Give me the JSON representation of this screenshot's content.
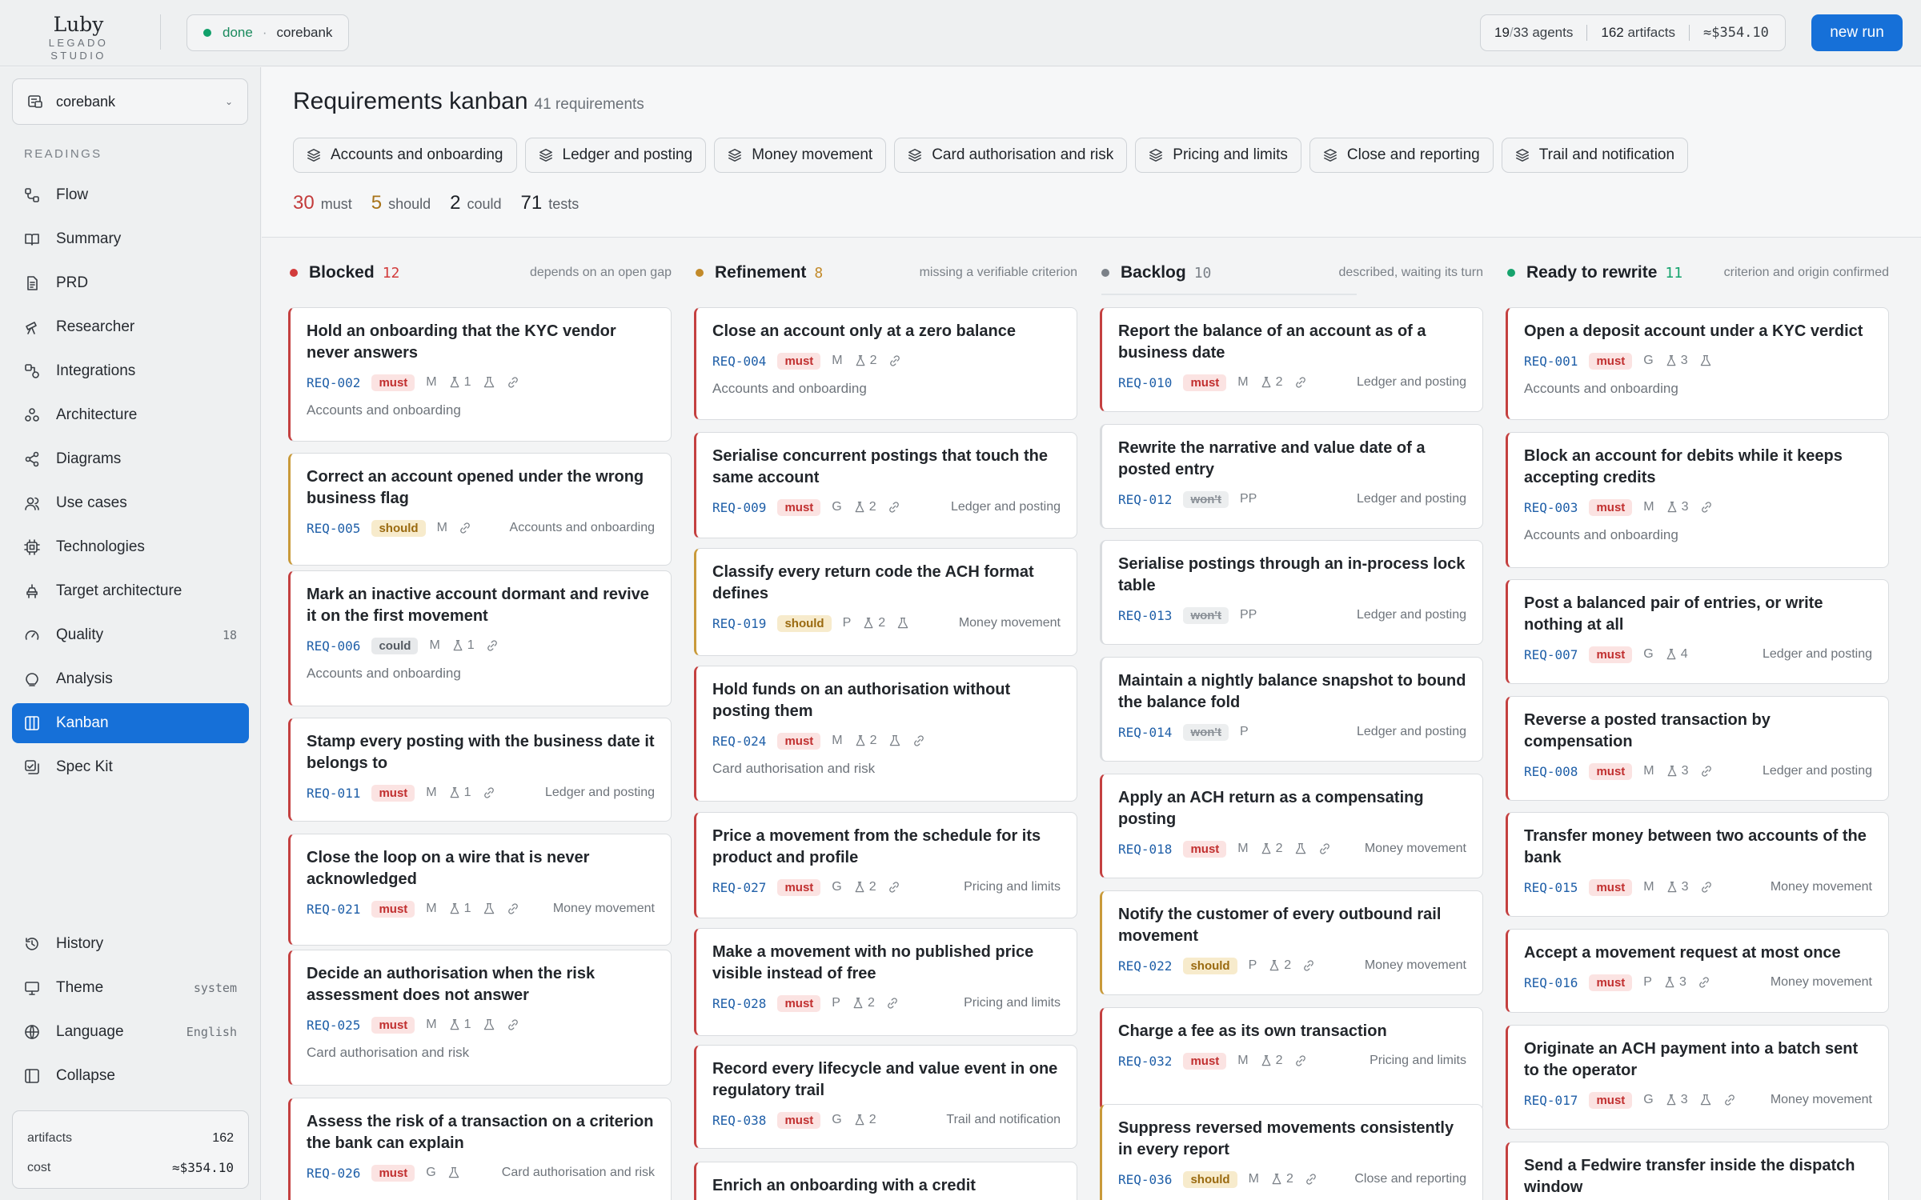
{
  "app": {
    "logo": "Luby",
    "logo_sub": "LEGADO STUDIO"
  },
  "run": {
    "status": "done",
    "sep": "·",
    "project": "corebank"
  },
  "stats": {
    "agents_done": "19",
    "agents_total": "33",
    "agents_label": "agents",
    "artifacts": "162",
    "artifacts_label": "artifacts",
    "cost": "≈$354.10"
  },
  "new_run_label": "new run",
  "sidebar": {
    "project": "corebank",
    "section_label": "READINGS",
    "items": [
      {
        "label": "Flow",
        "icon": "flow-icon"
      },
      {
        "label": "Summary",
        "icon": "book-icon"
      },
      {
        "label": "PRD",
        "icon": "document-icon"
      },
      {
        "label": "Researcher",
        "icon": "telescope-icon"
      },
      {
        "label": "Integrations",
        "icon": "integrations-icon"
      },
      {
        "label": "Architecture",
        "icon": "architecture-icon"
      },
      {
        "label": "Diagrams",
        "icon": "share-nodes-icon"
      },
      {
        "label": "Use cases",
        "icon": "users-icon"
      },
      {
        "label": "Technologies",
        "icon": "chip-icon"
      },
      {
        "label": "Target architecture",
        "icon": "target-architecture-icon"
      },
      {
        "label": "Quality",
        "icon": "gauge-icon",
        "meta": "18"
      },
      {
        "label": "Analysis",
        "icon": "analysis-icon"
      },
      {
        "label": "Kanban",
        "icon": "kanban-icon",
        "active": true
      },
      {
        "label": "Spec Kit",
        "icon": "spec-kit-icon"
      }
    ],
    "bottom": [
      {
        "label": "History",
        "icon": "history-icon"
      },
      {
        "label": "Theme",
        "icon": "monitor-icon",
        "meta": "system"
      },
      {
        "label": "Language",
        "icon": "globe-icon",
        "meta": "English"
      },
      {
        "label": "Collapse",
        "icon": "collapse-icon"
      }
    ],
    "footer": {
      "artifacts_label": "artifacts",
      "artifacts": "162",
      "cost_label": "cost",
      "cost": "≈$354.10"
    }
  },
  "page": {
    "title": "Requirements kanban",
    "count": "41 requirements",
    "areas": [
      "Accounts and onboarding",
      "Ledger and posting",
      "Money movement",
      "Card authorisation and risk",
      "Pricing and limits",
      "Close and reporting",
      "Trail and notification"
    ],
    "summary": {
      "must": "30",
      "must_label": "must",
      "should": "5",
      "should_label": "should",
      "could": "2",
      "could_label": "could",
      "tests": "71",
      "tests_label": "tests"
    }
  },
  "colors": {
    "must": "#c33b3b",
    "should": "#a8741a",
    "accent": "#1670d8",
    "done": "#11a06a"
  },
  "columns": [
    {
      "title": "Blocked",
      "count": "12",
      "desc": "depends on an open gap",
      "dot": "#d23b3b",
      "cards": [
        {
          "title": "Hold an onboarding that the KYC vendor never answers",
          "id": "REQ-002",
          "priority": "must",
          "src": "M",
          "tests": "1",
          "icons": [
            "flask",
            "link"
          ],
          "area": "Accounts and onboarding"
        },
        {
          "title": "Correct an account opened under the wrong business flag",
          "id": "REQ-005",
          "priority": "should",
          "src": "M",
          "icons": [
            "link"
          ],
          "area": "Accounts and onboarding"
        },
        {
          "title": "Mark an inactive account dormant and revive it on the first movement",
          "id": "REQ-006",
          "priority": "could",
          "src": "M",
          "tests": "1",
          "icons": [
            "link"
          ],
          "area": "Accounts and onboarding"
        },
        {
          "title": "Stamp every posting with the business date it belongs to",
          "id": "REQ-011",
          "priority": "must",
          "src": "M",
          "tests": "1",
          "icons": [
            "link"
          ],
          "area": "Ledger and posting"
        },
        {
          "title": "Close the loop on a wire that is never acknowledged",
          "id": "REQ-021",
          "priority": "must",
          "src": "M",
          "tests": "1",
          "icons": [
            "flask",
            "link"
          ],
          "area": "Money movement"
        },
        {
          "title": "Decide an authorisation when the risk assessment does not answer",
          "id": "REQ-025",
          "priority": "must",
          "src": "M",
          "tests": "1",
          "icons": [
            "flask",
            "link"
          ],
          "area": "Card authorisation and risk"
        },
        {
          "title": "Assess the risk of a transaction on a criterion the bank can explain",
          "id": "REQ-026",
          "priority": "must",
          "src": "G",
          "icons": [
            "flask"
          ],
          "area": "Card authorisation and risk"
        }
      ]
    },
    {
      "title": "Refinement",
      "count": "8",
      "desc": "missing a verifiable criterion",
      "dot": "#c28a2a",
      "cards": [
        {
          "title": "Close an account only at a zero balance",
          "id": "REQ-004",
          "priority": "must",
          "src": "M",
          "tests": "2",
          "icons": [
            "link"
          ],
          "area": "Accounts and onboarding"
        },
        {
          "title": "Serialise concurrent postings that touch the same account",
          "id": "REQ-009",
          "priority": "must",
          "src": "G",
          "tests": "2",
          "icons": [
            "link"
          ],
          "area": "Ledger and posting"
        },
        {
          "title": "Classify every return code the ACH format defines",
          "id": "REQ-019",
          "priority": "should",
          "src": "P",
          "tests": "2",
          "icons": [
            "flask"
          ],
          "area": "Money movement"
        },
        {
          "title": "Hold funds on an authorisation without posting them",
          "id": "REQ-024",
          "priority": "must",
          "src": "M",
          "tests": "2",
          "icons": [
            "flask",
            "link"
          ],
          "area": "Card authorisation and risk"
        },
        {
          "title": "Price a movement from the schedule for its product and profile",
          "id": "REQ-027",
          "priority": "must",
          "src": "G",
          "tests": "2",
          "icons": [
            "link"
          ],
          "area": "Pricing and limits"
        },
        {
          "title": "Make a movement with no published price visible instead of free",
          "id": "REQ-028",
          "priority": "must",
          "src": "P",
          "tests": "2",
          "icons": [
            "link"
          ],
          "area": "Pricing and limits"
        },
        {
          "title": "Record every lifecycle and value event in one regulatory trail",
          "id": "REQ-038",
          "priority": "must",
          "src": "G",
          "tests": "2",
          "icons": [],
          "area": "Trail and notification"
        },
        {
          "title": "Enrich an onboarding with a credit",
          "id": "",
          "priority": "",
          "src": "",
          "icons": [],
          "area": ""
        }
      ]
    },
    {
      "title": "Backlog",
      "count": "10",
      "desc": "described, waiting its turn",
      "dot": "#7b8188",
      "cards": [
        {
          "title": "Report the balance of an account as of a business date",
          "id": "REQ-010",
          "priority": "must",
          "src": "M",
          "tests": "2",
          "icons": [
            "link"
          ],
          "area": "Ledger and posting"
        },
        {
          "title": "Rewrite the narrative and value date of a posted entry",
          "id": "REQ-012",
          "priority": "won't",
          "src": "PP",
          "icons": [],
          "area": "Ledger and posting"
        },
        {
          "title": "Serialise postings through an in-process lock table",
          "id": "REQ-013",
          "priority": "won't",
          "src": "PP",
          "icons": [],
          "area": "Ledger and posting"
        },
        {
          "title": "Maintain a nightly balance snapshot to bound the balance fold",
          "id": "REQ-014",
          "priority": "won't",
          "src": "P",
          "icons": [],
          "area": "Ledger and posting"
        },
        {
          "title": "Apply an ACH return as a compensating posting",
          "id": "REQ-018",
          "priority": "must",
          "src": "M",
          "tests": "2",
          "icons": [
            "flask",
            "link"
          ],
          "area": "Money movement"
        },
        {
          "title": "Notify the customer of every outbound rail movement",
          "id": "REQ-022",
          "priority": "should",
          "src": "P",
          "tests": "2",
          "icons": [
            "link"
          ],
          "area": "Money movement"
        },
        {
          "title": "Charge a fee as its own transaction",
          "id": "REQ-032",
          "priority": "must",
          "src": "M",
          "tests": "2",
          "icons": [
            "link"
          ],
          "area": "Pricing and limits"
        },
        {
          "title": "Suppress reversed movements consistently in every report",
          "id": "REQ-036",
          "priority": "should",
          "src": "M",
          "tests": "2",
          "icons": [
            "link"
          ],
          "area": "Close and reporting"
        }
      ]
    },
    {
      "title": "Ready to rewrite",
      "count": "11",
      "desc": "criterion and origin confirmed",
      "dot": "#16a36d",
      "cards": [
        {
          "title": "Open a deposit account under a KYC verdict",
          "id": "REQ-001",
          "priority": "must",
          "src": "G",
          "tests": "3",
          "icons": [
            "flask"
          ],
          "area": "Accounts and onboarding"
        },
        {
          "title": "Block an account for debits while it keeps accepting credits",
          "id": "REQ-003",
          "priority": "must",
          "src": "M",
          "tests": "3",
          "icons": [
            "link"
          ],
          "area": "Accounts and onboarding"
        },
        {
          "title": "Post a balanced pair of entries, or write nothing at all",
          "id": "REQ-007",
          "priority": "must",
          "src": "G",
          "tests": "4",
          "icons": [],
          "area": "Ledger and posting"
        },
        {
          "title": "Reverse a posted transaction by compensation",
          "id": "REQ-008",
          "priority": "must",
          "src": "M",
          "tests": "3",
          "icons": [
            "link"
          ],
          "area": "Ledger and posting"
        },
        {
          "title": "Transfer money between two accounts of the bank",
          "id": "REQ-015",
          "priority": "must",
          "src": "M",
          "tests": "3",
          "icons": [
            "link"
          ],
          "area": "Money movement"
        },
        {
          "title": "Accept a movement request at most once",
          "id": "REQ-016",
          "priority": "must",
          "src": "P",
          "tests": "3",
          "icons": [
            "link"
          ],
          "area": "Money movement"
        },
        {
          "title": "Originate an ACH payment into a batch sent to the operator",
          "id": "REQ-017",
          "priority": "must",
          "src": "G",
          "tests": "3",
          "icons": [
            "flask",
            "link"
          ],
          "area": "Money movement"
        },
        {
          "title": "Send a Fedwire transfer inside the dispatch window",
          "id": "",
          "priority": "",
          "src": "",
          "icons": [],
          "area": ""
        }
      ]
    }
  ]
}
